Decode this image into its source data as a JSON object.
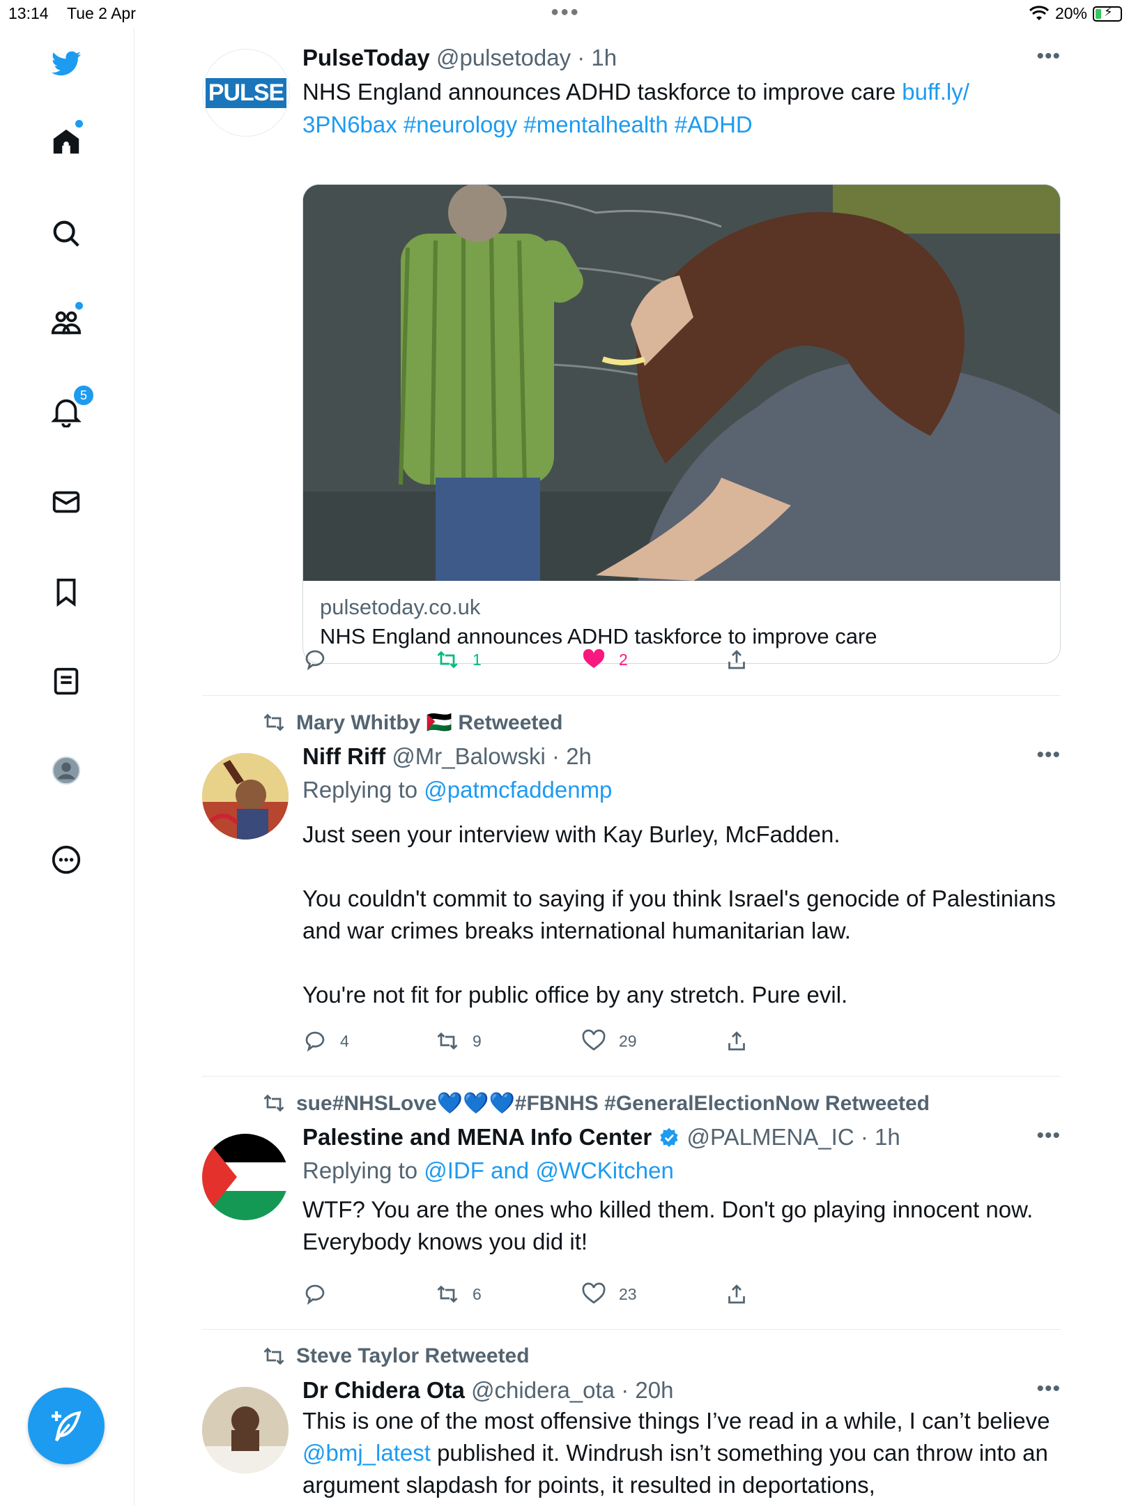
{
  "status_bar": {
    "time": "13:14",
    "date": "Tue 2 Apr",
    "battery": "20%"
  },
  "sidebar": {
    "notifications_badge": "5"
  },
  "tweets": [
    {
      "name": "PulseToday",
      "handle": "@pulsetoday",
      "time": "1h",
      "avatar_text": "PULSE",
      "text": "NHS England announces ADHD taskforce to improve care ",
      "link_text": "buff.ly/",
      "link_text_2": "3PN6bax",
      "hashtags": "#neurology #mentalhealth #ADHD",
      "card": {
        "domain": "pulsetoday.co.uk",
        "title": "NHS England announces ADHD taskforce to improve care"
      },
      "stats": {
        "replies": "",
        "retweets": "1",
        "likes": "2"
      }
    },
    {
      "retweeted_by": "Mary Whitby 🇵🇸 Retweeted",
      "name": "Niff Riff",
      "handle": "@Mr_Balowski",
      "time": "2h",
      "replying_prefix": "Replying to ",
      "replying_to": "@patmcfaddenmp",
      "paragraphs": [
        "Just seen your interview with Kay Burley, McFadden.",
        "You couldn't commit to saying if you think Israel's genocide of Palestinians and war crimes breaks international humanitarian law.",
        "You're not fit for public office by any stretch. Pure evil."
      ],
      "stats": {
        "replies": "4",
        "retweets": "9",
        "likes": "29"
      }
    },
    {
      "retweeted_by": "sue#NHSLove💙💙💙#FBNHS #GeneralElectionNow Retweeted",
      "name": "Palestine and MENA Info Center",
      "handle": "@PALMENA_IC",
      "time": "1h",
      "replying_prefix": "Replying to ",
      "replying_to": "@IDF and @WCKitchen",
      "text": "WTF? You are the ones who killed them. Don't go playing innocent now. Everybody knows you did it!",
      "stats": {
        "replies": "",
        "retweets": "6",
        "likes": "23"
      }
    },
    {
      "retweeted_by": "Steve Taylor Retweeted",
      "name": "Dr Chidera Ota",
      "handle": "@chidera_ota",
      "time": "20h",
      "text_a": "This is one of the most offensive things I’ve read in a while, I can’t believe ",
      "mention": "@bmj_latest",
      "text_b": " published it. Windrush isn’t something you can throw into an argument slapdash for points, it resulted in deportations,"
    }
  ],
  "colors": {
    "accent": "#1d9bf0",
    "retweet_green": "#00ba7c",
    "like_pink": "#f91880",
    "muted": "#536471"
  }
}
